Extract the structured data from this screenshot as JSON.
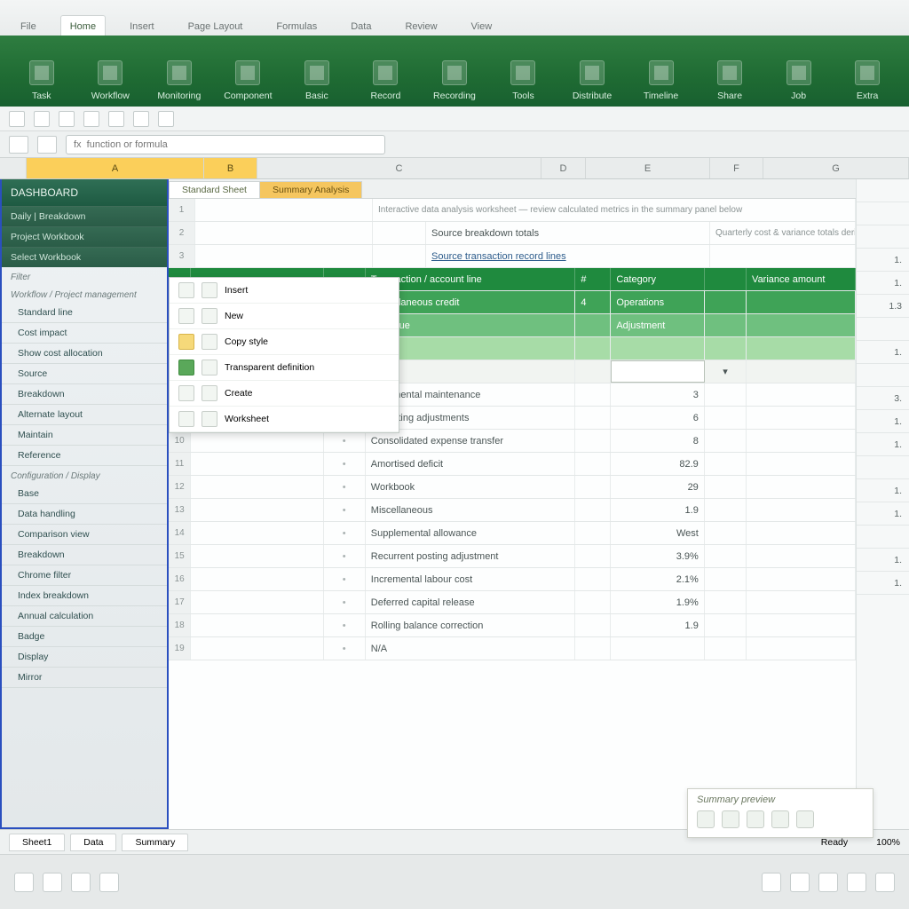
{
  "tabs": [
    "File",
    "Home",
    "Insert",
    "Page Layout",
    "Formulas",
    "Data",
    "Review",
    "View"
  ],
  "active_tab": 1,
  "ribbon_groups": [
    "Task",
    "Workflow",
    "Monitoring",
    "Component",
    "Basic",
    "Record",
    "Recording",
    "Tools",
    "Distribute",
    "Timeline",
    "Share",
    "Job",
    "Extra"
  ],
  "formula_placeholder": "fx  function or formula",
  "columns": [
    "",
    "A",
    "B",
    "C",
    "D",
    "E",
    "F",
    "G"
  ],
  "selected_cols": [
    1,
    2
  ],
  "ws_tabs": [
    "Standard Sheet",
    "Summary Analysis"
  ],
  "ws_active": 0,
  "info_line": "Interactive data analysis worksheet — review calculated metrics in the summary panel below",
  "section_a": "Source breakdown totals",
  "section_b": "Quarterly cost & variance totals derived from the selected transaction filter",
  "section_c": "Source transaction record lines",
  "header_row": {
    "c": "Transaction / account line",
    "d": "#",
    "e": "Category",
    "g": "Variance amount"
  },
  "green_rows": [
    {
      "c": "Miscellaneous credit",
      "d": "4",
      "e": "Operations"
    },
    {
      "c": "Revenue",
      "d": "",
      "e": "Adjustment"
    },
    {
      "c": "Other",
      "d": "",
      "e": ""
    }
  ],
  "data_rows": [
    {
      "c": "Incremental maintenance",
      "v": "3"
    },
    {
      "c": "Operating adjustments",
      "v": "6"
    },
    {
      "c": "Consolidated expense transfer",
      "v": "8"
    },
    {
      "c": "Amortised deficit",
      "v": "82.9"
    },
    {
      "c": "Workbook",
      "v": "29"
    },
    {
      "c": "Miscellaneous",
      "v": "1.9"
    },
    {
      "c": "Supplemental allowance",
      "v": "West"
    },
    {
      "c": "Recurrent posting adjustment",
      "v": "3.9%"
    },
    {
      "c": "Incremental labour cost",
      "v": "2.1%"
    },
    {
      "c": "Deferred capital release",
      "v": "1.9%"
    },
    {
      "c": "Rolling balance correction",
      "v": "1.9"
    },
    {
      "c": "N/A",
      "v": ""
    }
  ],
  "side": {
    "title": "DASHBOARD",
    "sections": [
      "Daily | Breakdown",
      "Project Workbook",
      "Select Workbook"
    ],
    "filter_label": "Filter",
    "group1_label": "Workflow / Project management",
    "group1": [
      "Standard line",
      "Cost impact",
      "Show cost allocation",
      "Source",
      "Breakdown",
      "Alternate layout",
      "Maintain",
      "Reference"
    ],
    "group2_label": "Configuration / Display",
    "group2": [
      "Base",
      "Data handling",
      "Comparison view",
      "Breakdown",
      "Chrome filter",
      "Index breakdown",
      "Annual calculation",
      "Badge",
      "Display",
      "Mirror"
    ]
  },
  "ctx": {
    "rows": [
      {
        "label": "Insert",
        "style": ""
      },
      {
        "label": "New",
        "style": ""
      },
      {
        "label": "Copy style",
        "style": "y"
      },
      {
        "label": "Transparent definition",
        "style": "g"
      },
      {
        "label": "Create",
        "style": ""
      },
      {
        "label": "Worksheet",
        "style": ""
      }
    ]
  },
  "right_values": [
    "",
    "",
    "",
    "1.",
    "1.",
    "1.3",
    "",
    "1.",
    "",
    "3.",
    "1.",
    "1.",
    "",
    "1.",
    "1.",
    "",
    "1.",
    "1."
  ],
  "statusbar": {
    "zoom": "100%",
    "mode": "Ready"
  },
  "sheet_tabs": [
    "Sheet1",
    "Data",
    "Summary"
  ],
  "callout": {
    "title": "Summary preview"
  }
}
